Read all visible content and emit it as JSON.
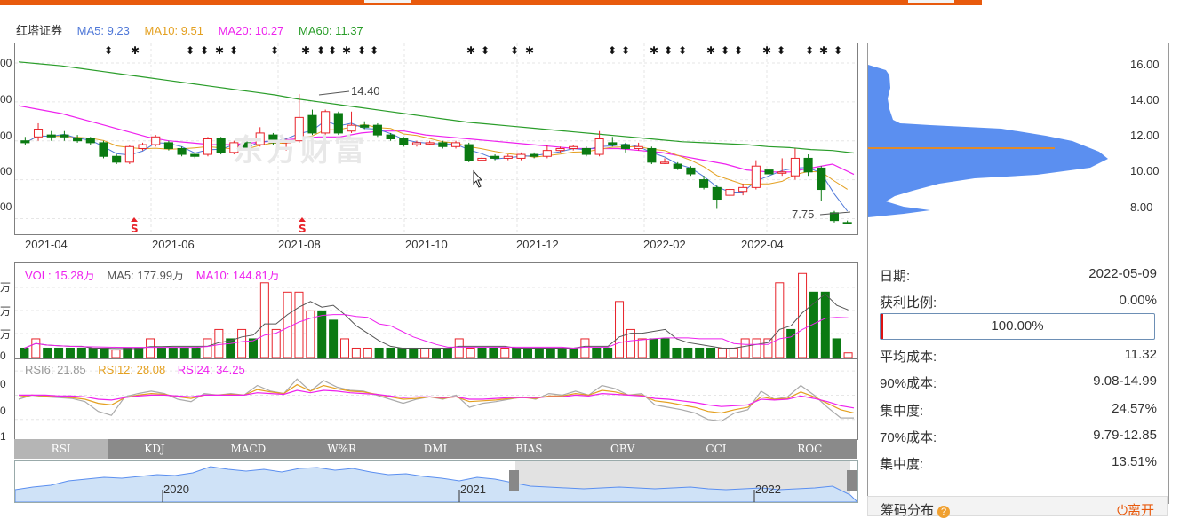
{
  "stock_name": "红塔证券",
  "price_legend": {
    "ma5": {
      "label": "MA5: 9.23",
      "color": "#4f78d8"
    },
    "ma10": {
      "label": "MA10: 9.51",
      "color": "#e4a020"
    },
    "ma20": {
      "label": "MA20: 10.27",
      "color": "#ee22ee"
    },
    "ma60": {
      "label": "MA60: 11.37",
      "color": "#2a9d2a"
    }
  },
  "colors": {
    "up": "#e8232a",
    "down": "#0b7a12",
    "accent": "#e85a0d",
    "chip": "#5b8ff0",
    "avg_cost_line": "#e08a2a"
  },
  "watermark": "东方财富",
  "price_axis": [
    "16.00",
    "14.00",
    "12.00",
    "10.00",
    "8.00"
  ],
  "left_axis_cut": [
    "00",
    "00",
    "00",
    "00",
    "00"
  ],
  "x_labels": [
    "2021-04",
    "2021-06",
    "2021-08",
    "2021-10",
    "2021-12",
    "2022-02",
    "2022-04"
  ],
  "annotations": {
    "high": "14.40",
    "low": "7.75"
  },
  "signal_marker": "S",
  "volume_legend": {
    "vol": {
      "label": "VOL: 15.28万",
      "color": "#ee22ee"
    },
    "ma5": {
      "label": "MA5: 177.99万",
      "color": "#555555"
    },
    "ma10": {
      "label": "MA10: 144.81万",
      "color": "#ee22ee"
    }
  },
  "volume_axis_cut": [
    "万",
    "万",
    "万",
    "0"
  ],
  "rsi_legend": {
    "rsi6": {
      "label": "RSI6: 21.85",
      "color": "#999999"
    },
    "rsi12": {
      "label": "RSI12: 28.08",
      "color": "#e4a020"
    },
    "rsi24": {
      "label": "RSI24: 34.25",
      "color": "#ee22ee"
    }
  },
  "rsi_axis_cut": [
    "0",
    "0",
    "1"
  ],
  "indicator_tabs": [
    "RSI",
    "KDJ",
    "MACD",
    "W%R",
    "DMI",
    "BIAS",
    "OBV",
    "CCI",
    "ROC"
  ],
  "active_tab": "RSI",
  "navigator_years": [
    "2020",
    "2021",
    "2022"
  ],
  "chip_panel": {
    "date_label": "日期:",
    "date": "2022-05-09",
    "profit_label": "获利比例:",
    "profit": "0.00%",
    "progress": "100.00%",
    "progress_value": 1.0,
    "avg_cost_label": "平均成本:",
    "avg_cost": "11.32",
    "cost90_label": "90%成本:",
    "cost90": "9.08-14.99",
    "conc90_label": "集中度:",
    "conc90": "24.57%",
    "cost70_label": "70%成本:",
    "cost70": "9.79-12.85",
    "conc70_label": "集中度:",
    "conc70": "13.51%"
  },
  "footer": {
    "title": "筹码分布",
    "help": "?",
    "leave": "离开",
    "leave_icon": "power-icon"
  },
  "chart_data": {
    "type": "candlestick",
    "title": "红塔证券",
    "ylim": [
      7.2,
      17.0
    ],
    "candles": [
      [
        12.0,
        11.9,
        12.2,
        11.8
      ],
      [
        12.2,
        12.6,
        12.9,
        12.0
      ],
      [
        12.3,
        12.2,
        12.5,
        12.0
      ],
      [
        12.3,
        12.2,
        12.5,
        12.0
      ],
      [
        12.1,
        12.0,
        12.3,
        11.9
      ],
      [
        12.1,
        11.9,
        12.2,
        11.8
      ],
      [
        11.9,
        11.2,
        12.0,
        11.1
      ],
      [
        11.2,
        10.9,
        11.3,
        10.8
      ],
      [
        10.9,
        11.7,
        11.8,
        10.8
      ],
      [
        11.6,
        11.8,
        11.9,
        11.5
      ],
      [
        11.8,
        12.2,
        12.3,
        11.7
      ],
      [
        11.9,
        11.6,
        12.0,
        11.5
      ],
      [
        11.6,
        11.3,
        11.7,
        11.2
      ],
      [
        11.3,
        11.2,
        11.4,
        11.1
      ],
      [
        11.3,
        12.1,
        12.2,
        11.2
      ],
      [
        12.1,
        11.4,
        12.2,
        11.3
      ],
      [
        11.4,
        11.9,
        12.0,
        11.3
      ],
      [
        11.9,
        11.6,
        12.0,
        11.5
      ],
      [
        11.8,
        12.4,
        12.7,
        11.7
      ],
      [
        12.3,
        11.9,
        12.4,
        11.8
      ],
      [
        11.9,
        12.0,
        12.1,
        11.5
      ],
      [
        12.0,
        13.2,
        14.4,
        11.9
      ],
      [
        13.3,
        12.4,
        13.6,
        12.3
      ],
      [
        12.4,
        13.5,
        13.6,
        12.3
      ],
      [
        13.4,
        12.4,
        13.5,
        12.3
      ],
      [
        12.5,
        12.8,
        13.5,
        12.4
      ],
      [
        12.8,
        12.7,
        13.0,
        12.6
      ],
      [
        12.8,
        12.3,
        12.9,
        12.2
      ],
      [
        12.3,
        12.1,
        12.4,
        12.0
      ],
      [
        12.1,
        11.8,
        12.2,
        11.7
      ],
      [
        11.8,
        11.9,
        12.0,
        11.7
      ],
      [
        11.9,
        11.9,
        12.0,
        11.8
      ],
      [
        11.9,
        11.7,
        12.0,
        11.6
      ],
      [
        11.7,
        11.9,
        12.0,
        11.6
      ],
      [
        11.8,
        11.0,
        11.9,
        10.9
      ],
      [
        11.0,
        11.1,
        11.2,
        11.0
      ],
      [
        11.2,
        11.1,
        11.3,
        11.0
      ],
      [
        11.1,
        11.2,
        11.3,
        11.0
      ],
      [
        11.1,
        11.3,
        11.4,
        11.0
      ],
      [
        11.3,
        11.2,
        11.4,
        11.1
      ],
      [
        11.2,
        11.5,
        11.8,
        11.1
      ],
      [
        11.5,
        11.6,
        11.7,
        11.4
      ],
      [
        11.6,
        11.7,
        11.8,
        11.5
      ],
      [
        11.6,
        11.3,
        11.7,
        11.2
      ],
      [
        11.3,
        12.1,
        12.5,
        11.2
      ],
      [
        11.9,
        11.8,
        12.2,
        11.7
      ],
      [
        11.8,
        11.6,
        11.9,
        11.4
      ],
      [
        11.6,
        11.7,
        11.9,
        11.5
      ],
      [
        11.6,
        10.9,
        11.7,
        10.8
      ],
      [
        10.9,
        10.9,
        11.1,
        10.8
      ],
      [
        10.8,
        10.6,
        10.9,
        10.5
      ],
      [
        10.6,
        10.3,
        10.7,
        10.2
      ],
      [
        10.0,
        9.6,
        10.2,
        9.5
      ],
      [
        9.6,
        9.0,
        9.7,
        8.5
      ],
      [
        9.2,
        9.5,
        9.6,
        9.1
      ],
      [
        9.4,
        9.6,
        9.8,
        9.2
      ],
      [
        9.6,
        10.7,
        11.0,
        9.5
      ],
      [
        10.5,
        10.3,
        10.6,
        10.1
      ],
      [
        10.4,
        10.4,
        11.1,
        10.2
      ],
      [
        10.2,
        11.1,
        11.6,
        10.0
      ],
      [
        11.1,
        10.4,
        11.3,
        10.2
      ],
      [
        10.6,
        9.5,
        10.7,
        8.9
      ],
      [
        8.3,
        7.9,
        8.4,
        7.8
      ],
      [
        7.8,
        7.75,
        7.9,
        7.75
      ]
    ],
    "ma60": [
      16.05,
      15.95,
      15.85,
      15.7,
      15.55,
      15.4,
      15.25,
      15.1,
      14.95,
      14.8,
      14.65,
      14.5,
      14.35,
      14.15,
      14.0,
      13.85,
      13.7,
      13.55,
      13.4,
      13.25,
      13.1,
      12.95,
      12.85,
      12.75,
      12.65,
      12.55,
      12.45,
      12.35,
      12.25,
      12.15,
      12.05,
      11.95,
      11.9,
      11.85,
      11.8,
      11.7,
      11.65,
      11.55,
      11.5,
      11.37
    ],
    "ma20": [
      13.8,
      13.6,
      13.4,
      13.1,
      12.8,
      12.5,
      12.2,
      12.0,
      11.9,
      11.8,
      11.8,
      11.9,
      12.0,
      12.1,
      12.2,
      12.2,
      12.4,
      12.5,
      12.5,
      12.3,
      12.2,
      12.1,
      12.0,
      11.9,
      11.8,
      11.7,
      11.6,
      11.6,
      11.6,
      11.5,
      11.4,
      11.2,
      11.0,
      10.8,
      10.5,
      10.4,
      10.4,
      10.6,
      10.8,
      10.27
    ],
    "volume": [
      1,
      2,
      1,
      1,
      1,
      1,
      1,
      1,
      0.8,
      1,
      1,
      2,
      1,
      1,
      1,
      1,
      2,
      3,
      2,
      3,
      2,
      8,
      3,
      7,
      7,
      5,
      5,
      4,
      2,
      1,
      1,
      1,
      1,
      1,
      1,
      1,
      1,
      1,
      2,
      1,
      1,
      1,
      1,
      1,
      1,
      1,
      1,
      1,
      1,
      2,
      1,
      1,
      6,
      3,
      2,
      2,
      2,
      1,
      1,
      1,
      1,
      1,
      1,
      2,
      2,
      2,
      8,
      3,
      9,
      7,
      7,
      2,
      0.5
    ],
    "volume_up": [
      false,
      true,
      false,
      false,
      false,
      false,
      false,
      false,
      true,
      false,
      false,
      true,
      false,
      false,
      false,
      false,
      true,
      true,
      false,
      true,
      false,
      true,
      true,
      true,
      true,
      true,
      false,
      false,
      true,
      true,
      true,
      false,
      false,
      false,
      false,
      true,
      false,
      false,
      true,
      true,
      false,
      false,
      true,
      false,
      false,
      false,
      false,
      false,
      false,
      true,
      false,
      false,
      true,
      true,
      true,
      false,
      false,
      false,
      false,
      false,
      false,
      true,
      true,
      true,
      true,
      true,
      true,
      false,
      true,
      false,
      false,
      false,
      true
    ],
    "rsi6": [
      45,
      50,
      48,
      47,
      46,
      42,
      30,
      25,
      48,
      52,
      55,
      52,
      45,
      42,
      52,
      50,
      52,
      50,
      62,
      55,
      52,
      70,
      55,
      68,
      60,
      56,
      55,
      50,
      45,
      40,
      45,
      48,
      45,
      50,
      35,
      40,
      42,
      45,
      48,
      45,
      52,
      50,
      55,
      50,
      62,
      58,
      50,
      52,
      38,
      35,
      32,
      28,
      20,
      18,
      28,
      32,
      55,
      45,
      48,
      62,
      50,
      35,
      22,
      21.85
    ],
    "rsi12": [
      48,
      50,
      49,
      48,
      47,
      45,
      40,
      38,
      47,
      50,
      52,
      51,
      48,
      46,
      50,
      50,
      51,
      50,
      57,
      54,
      52,
      63,
      55,
      62,
      58,
      55,
      54,
      51,
      48,
      45,
      46,
      48,
      46,
      48,
      42,
      43,
      44,
      46,
      47,
      46,
      49,
      49,
      52,
      50,
      56,
      54,
      50,
      50,
      43,
      41,
      38,
      35,
      30,
      28,
      32,
      35,
      48,
      45,
      46,
      54,
      48,
      40,
      32,
      28.08
    ],
    "rsi24": [
      50,
      50,
      50,
      49,
      49,
      48,
      45,
      44,
      47,
      49,
      50,
      50,
      49,
      48,
      50,
      50,
      50,
      50,
      53,
      52,
      51,
      56,
      53,
      56,
      55,
      53,
      52,
      51,
      49,
      47,
      48,
      48,
      47,
      48,
      45,
      45,
      46,
      47,
      47,
      47,
      48,
      48,
      50,
      49,
      52,
      51,
      50,
      49,
      46,
      45,
      43,
      41,
      38,
      36,
      37,
      38,
      45,
      44,
      45,
      49,
      46,
      42,
      37,
      34.25
    ]
  }
}
